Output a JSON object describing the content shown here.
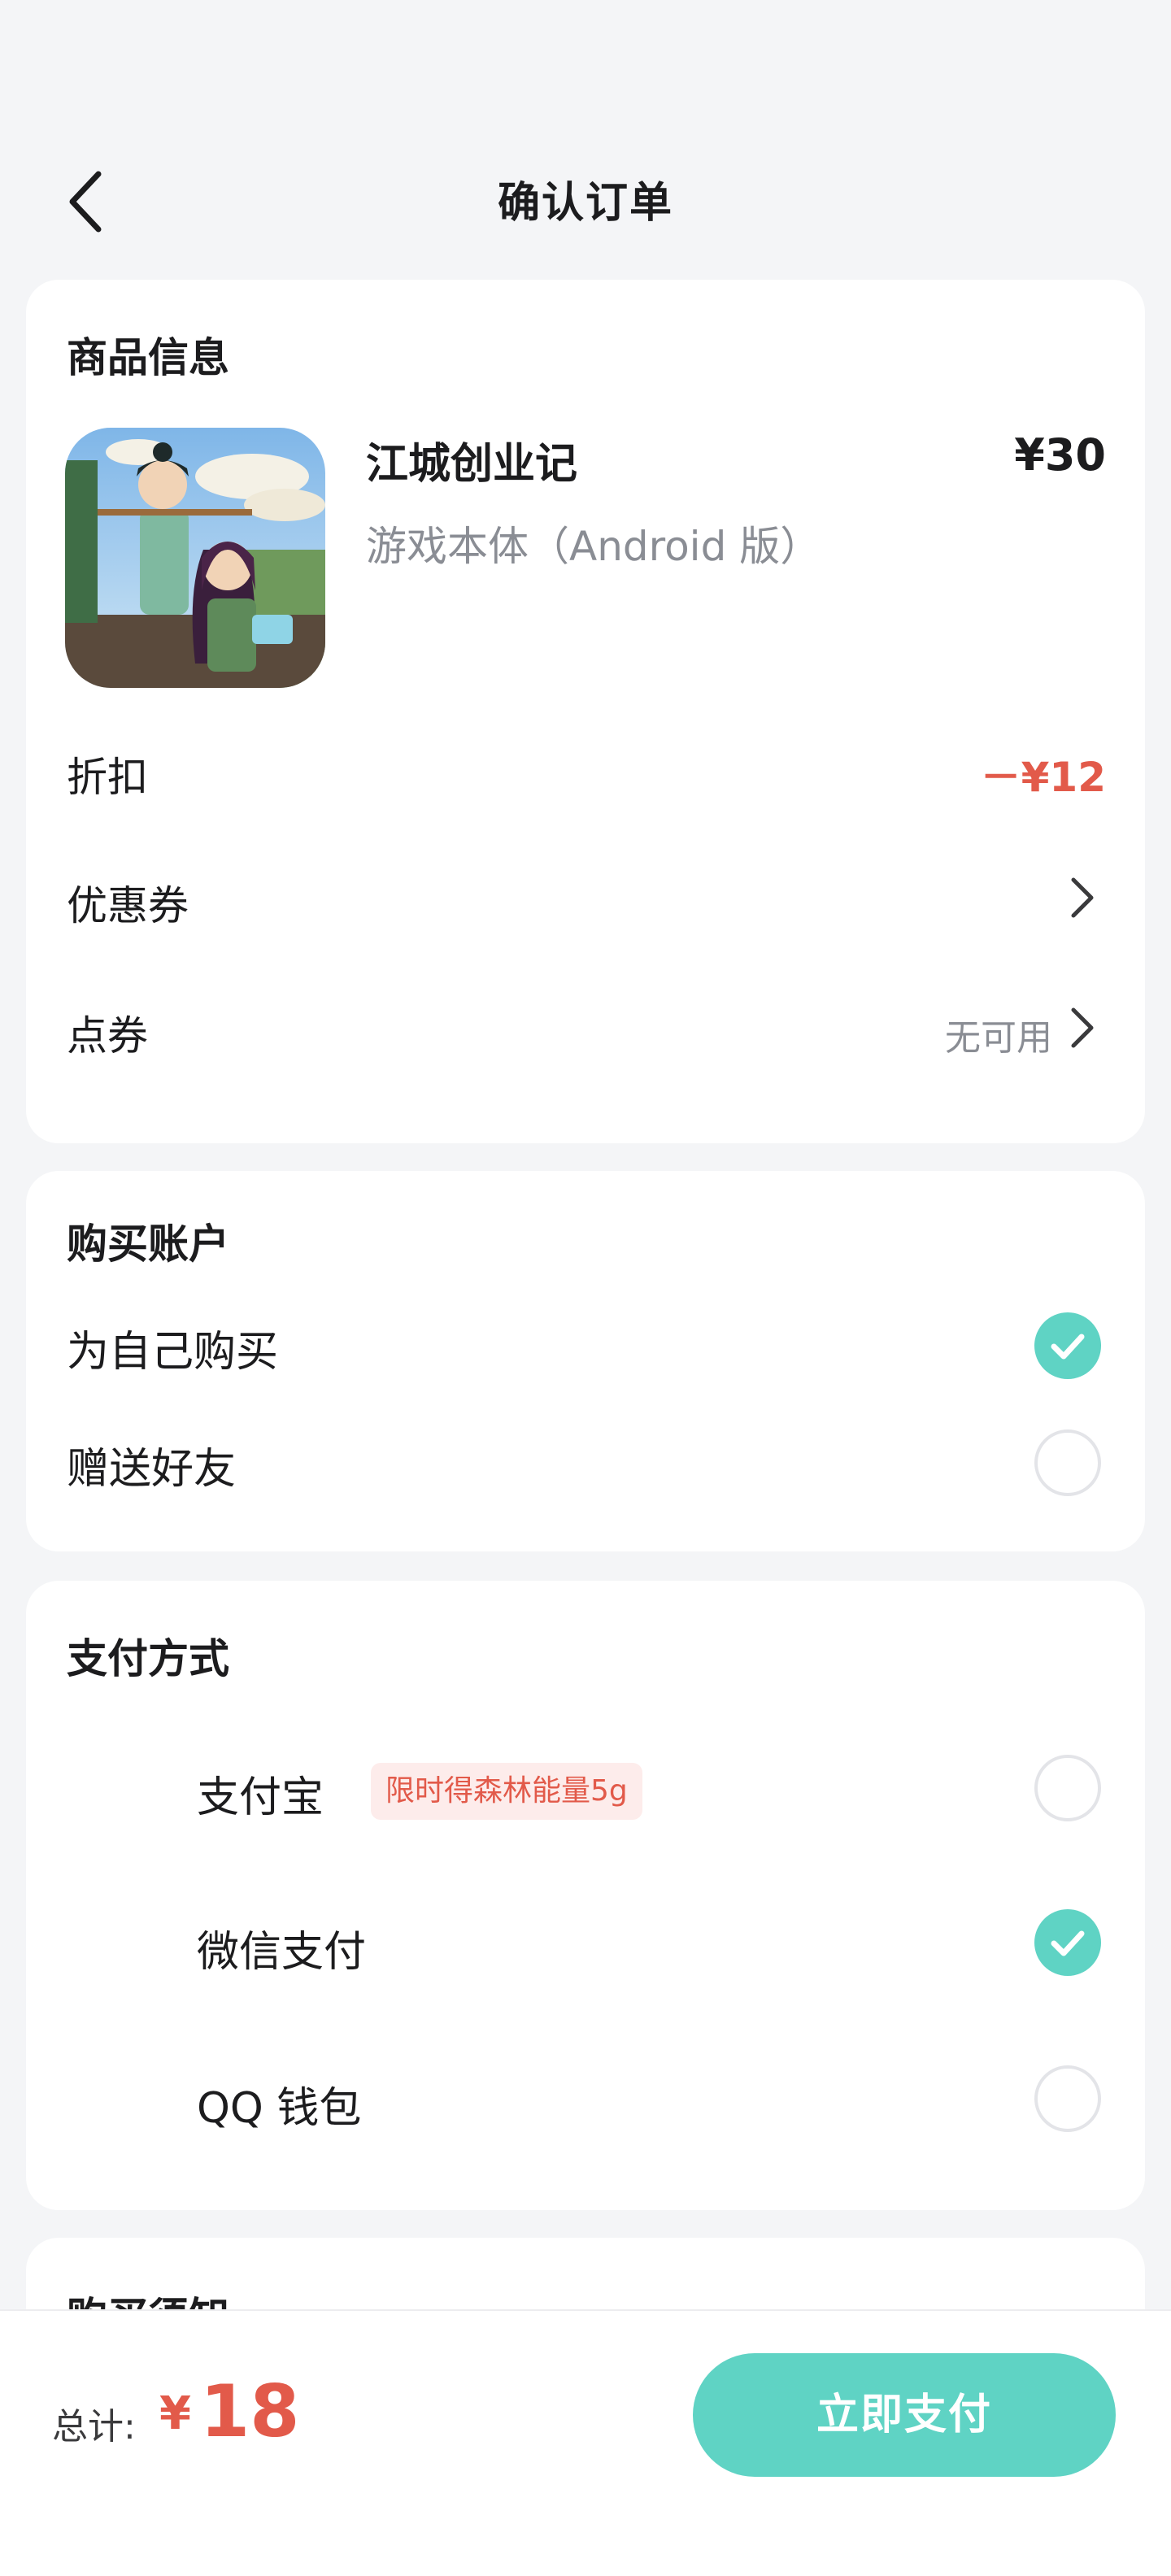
{
  "header": {
    "title": "确认订单"
  },
  "product_card": {
    "section_title": "商品信息",
    "product": {
      "name": "江城创业记",
      "price": "¥30",
      "edition": "游戏本体（Android 版）"
    },
    "discount": {
      "label": "折扣",
      "value": "－¥12"
    },
    "coupon": {
      "label": "优惠券"
    },
    "points": {
      "label": "点券",
      "value": "无可用"
    }
  },
  "account_card": {
    "section_title": "购买账户",
    "options": [
      {
        "label": "为自己购买",
        "selected": true
      },
      {
        "label": "赠送好友",
        "selected": false
      }
    ]
  },
  "payment_card": {
    "section_title": "支付方式",
    "methods": [
      {
        "label": "支付宝",
        "tag": "限时得森林能量5g",
        "selected": false
      },
      {
        "label": "微信支付",
        "selected": true
      },
      {
        "label": "QQ 钱包",
        "selected": false
      }
    ]
  },
  "notice_card": {
    "section_title": "购买须知"
  },
  "bottom_bar": {
    "total_label": "总计:",
    "currency": "¥",
    "total_amount": "18",
    "pay_button": "立即支付"
  },
  "colors": {
    "accent": "#5fd3c4",
    "price_red": "#e25a4a",
    "background": "#f4f5f7"
  }
}
